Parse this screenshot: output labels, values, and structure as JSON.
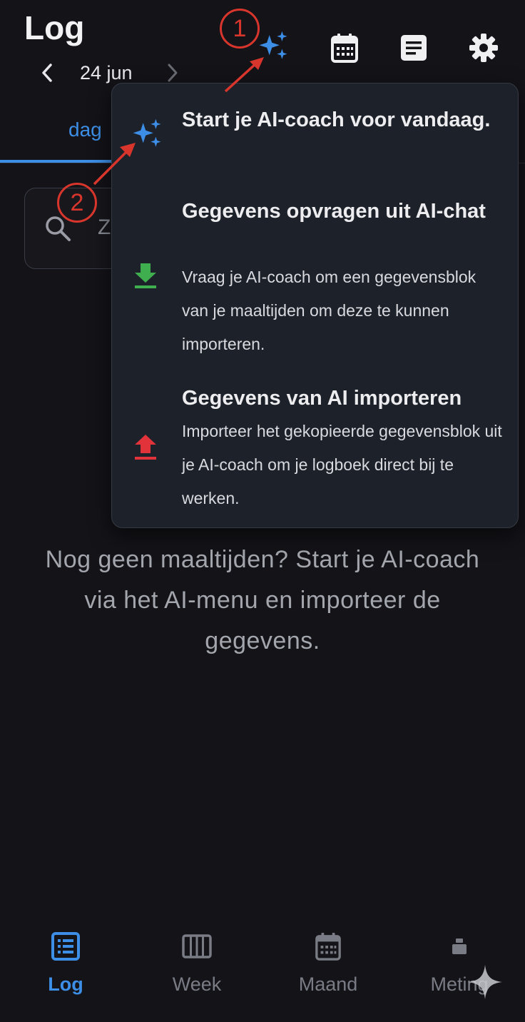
{
  "header": {
    "title": "Log",
    "date": "24 jun"
  },
  "tabs": {
    "active_label": "dag"
  },
  "search": {
    "placeholder_visible": "Z"
  },
  "ai_menu": {
    "items": [
      {
        "icon": "sparkle-icon",
        "title": "Start je AI-coach voor vandaag.",
        "description": ""
      },
      {
        "icon": "download-icon",
        "title": "Gegevens opvragen uit AI-chat",
        "description": "Vraag je AI-coach om een gegevensblok van je maaltijden om deze te kunnen importeren."
      },
      {
        "icon": "upload-icon",
        "title": "Gegevens van AI importeren",
        "description": "Importeer het gekopieerde gegevensblok uit je AI-coach om je logboek direct bij te werken."
      }
    ]
  },
  "empty_state": {
    "message": "Nog geen maaltijden? Start je AI-coach via het AI-menu en importeer de gegevens."
  },
  "bottom_nav": {
    "items": [
      {
        "label": "Log",
        "icon": "list-icon",
        "active": true
      },
      {
        "label": "Week",
        "icon": "week-columns-icon",
        "active": false
      },
      {
        "label": "Maand",
        "icon": "calendar-icon",
        "active": false
      },
      {
        "label": "Meting",
        "icon": "scale-icon",
        "active": false
      }
    ]
  },
  "annotations": {
    "step1": "1",
    "step2": "2"
  },
  "colors": {
    "accent": "#3d8ee6",
    "background": "#131318",
    "menu_bg": "#1d2129",
    "download": "#3fae4e",
    "upload": "#e2333a",
    "annotation": "#d8362c"
  }
}
